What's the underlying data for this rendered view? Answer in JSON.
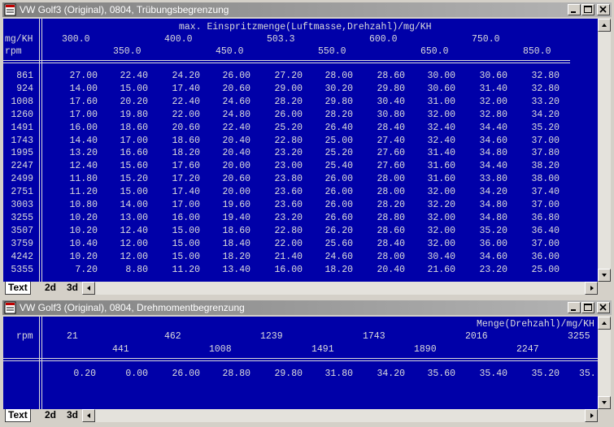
{
  "window1": {
    "title": "VW Golf3 (Original), 0804, Trübungsbegrenzung",
    "heading": "max. Einspritzmenge(Luftmasse,Drehzahl)/mg/KH",
    "x_unit": "mg/KH",
    "y_unit": "rpm",
    "x_top": [
      "300.0",
      "400.0",
      "503.3",
      "600.0",
      "750.0"
    ],
    "x_bottom": [
      "350.0",
      "450.0",
      "550.0",
      "650.0",
      "850.0"
    ],
    "rows": [
      [
        "861",
        "27.00",
        "22.40",
        "24.20",
        "26.00",
        "27.20",
        "28.00",
        "28.60",
        "30.00",
        "30.60",
        "32.80"
      ],
      [
        "924",
        "14.00",
        "15.00",
        "17.40",
        "20.60",
        "29.00",
        "30.20",
        "29.80",
        "30.60",
        "31.40",
        "32.80"
      ],
      [
        "1008",
        "17.60",
        "20.20",
        "22.40",
        "24.60",
        "28.20",
        "29.80",
        "30.40",
        "31.00",
        "32.00",
        "33.20"
      ],
      [
        "1260",
        "17.00",
        "19.80",
        "22.00",
        "24.80",
        "26.00",
        "28.20",
        "30.80",
        "32.00",
        "32.80",
        "34.20"
      ],
      [
        "1491",
        "16.00",
        "18.60",
        "20.60",
        "22.40",
        "25.20",
        "26.40",
        "28.40",
        "32.40",
        "34.40",
        "35.20"
      ],
      [
        "1743",
        "14.40",
        "17.00",
        "18.60",
        "20.40",
        "22.80",
        "25.00",
        "27.40",
        "32.40",
        "34.60",
        "37.00"
      ],
      [
        "1995",
        "13.20",
        "16.60",
        "18.20",
        "20.40",
        "23.20",
        "25.20",
        "27.60",
        "31.40",
        "34.80",
        "37.80"
      ],
      [
        "2247",
        "12.40",
        "15.60",
        "17.60",
        "20.00",
        "23.00",
        "25.40",
        "27.60",
        "31.60",
        "34.40",
        "38.20"
      ],
      [
        "2499",
        "11.80",
        "15.20",
        "17.20",
        "20.60",
        "23.80",
        "26.00",
        "28.00",
        "31.60",
        "33.80",
        "38.00"
      ],
      [
        "2751",
        "11.20",
        "15.00",
        "17.40",
        "20.00",
        "23.60",
        "26.00",
        "28.00",
        "32.00",
        "34.20",
        "37.40"
      ],
      [
        "3003",
        "10.80",
        "14.00",
        "17.00",
        "19.60",
        "23.60",
        "26.00",
        "28.20",
        "32.20",
        "34.80",
        "37.00"
      ],
      [
        "3255",
        "10.20",
        "13.00",
        "16.00",
        "19.40",
        "23.20",
        "26.60",
        "28.80",
        "32.00",
        "34.80",
        "36.80"
      ],
      [
        "3507",
        "10.20",
        "12.40",
        "15.00",
        "18.60",
        "22.80",
        "26.20",
        "28.60",
        "32.00",
        "35.20",
        "36.40"
      ],
      [
        "3759",
        "10.40",
        "12.00",
        "15.00",
        "18.40",
        "22.00",
        "25.60",
        "28.40",
        "32.00",
        "36.00",
        "37.00"
      ],
      [
        "4242",
        "10.20",
        "12.00",
        "15.00",
        "18.20",
        "21.40",
        "24.60",
        "28.00",
        "30.40",
        "34.60",
        "36.00"
      ],
      [
        "5355",
        "7.20",
        "8.80",
        "11.20",
        "13.40",
        "16.00",
        "18.20",
        "20.40",
        "21.60",
        "23.20",
        "25.00"
      ]
    ],
    "tabs": [
      "Text",
      "2d",
      "3d"
    ]
  },
  "window2": {
    "title": "VW Golf3 (Original), 0804, Drehmomentbegrenzung",
    "heading": "Menge(Drehzahl)/mg/KH",
    "y_unit": "rpm",
    "x_top": [
      "21",
      "462",
      "1239",
      "1743",
      "2016",
      "3255"
    ],
    "x_bottom": [
      "441",
      "1008",
      "1491",
      "1890",
      "2247"
    ],
    "values": [
      "0.20",
      "0.00",
      "26.00",
      "28.80",
      "29.80",
      "31.80",
      "34.20",
      "35.60",
      "35.40",
      "35.20",
      "35."
    ],
    "tabs": [
      "Text",
      "2d",
      "3d"
    ]
  },
  "icons": {
    "window": "map-window-icon",
    "minimize": "minimize-icon",
    "maximize": "maximize-icon",
    "close": "close-icon"
  },
  "colors": {
    "client_bg": "#0000a8",
    "text": "#dcdcdc",
    "titlebar": "#808080"
  }
}
